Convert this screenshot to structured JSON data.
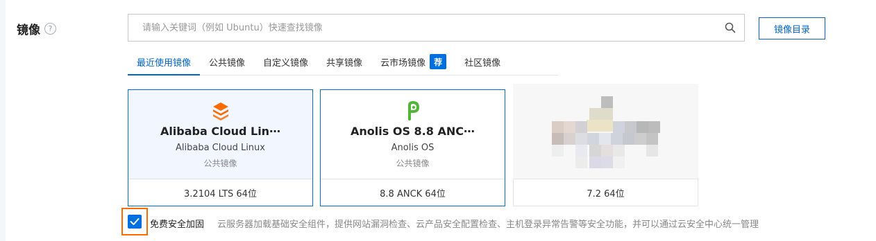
{
  "section": {
    "label": "镜像",
    "help_icon": "help-circle-icon"
  },
  "search": {
    "placeholder": "请输入关键词（例如 Ubuntu）快速查找镜像",
    "value": "",
    "icon": "search-icon"
  },
  "catalog_button": {
    "label": "镜像目录"
  },
  "tabs": [
    {
      "label": "最近使用镜像",
      "active": true
    },
    {
      "label": "公共镜像",
      "active": false
    },
    {
      "label": "自定义镜像",
      "active": false
    },
    {
      "label": "共享镜像",
      "active": false
    },
    {
      "label": "云市场镜像",
      "active": false,
      "badge": "荐"
    },
    {
      "label": "社区镜像",
      "active": false
    }
  ],
  "cards": [
    {
      "title": "Alibaba Cloud Lin⋯",
      "subtitle": "Alibaba Cloud Linux",
      "type": "公共镜像",
      "version": "3.2104 LTS 64位",
      "logo": "alibaba-cloud-linux-logo-icon",
      "selected": true
    },
    {
      "title": "Anolis OS 8.8 ANC⋯",
      "subtitle": "Anolis OS",
      "type": "公共镜像",
      "version": "8.8 ANCK 64位",
      "logo": "anolis-logo-icon",
      "selected": false
    },
    {
      "title": "",
      "subtitle": "",
      "type": "",
      "version": "7.2 64位",
      "logo": "blurred-image-placeholder",
      "selected": false
    }
  ],
  "security": {
    "checked": true,
    "label": "免费安全加固",
    "description": "云服务器加载基础安全组件，提供网站漏洞检查、云产品安全配置检查、主机登录异常告警等安全功能，并可以通过云安全中心统一管理"
  },
  "colors": {
    "accent": "#0064c8",
    "highlight_border": "#ff6a00",
    "alibaba_orange": "#ff6a00",
    "anolis_green": "#52b535"
  }
}
